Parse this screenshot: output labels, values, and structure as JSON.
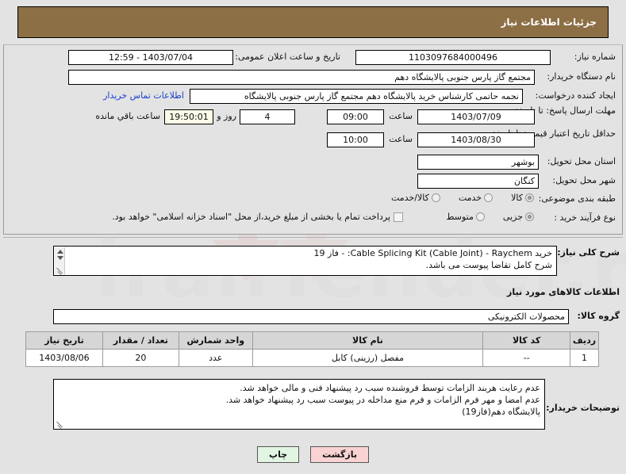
{
  "header": {
    "title": "جزئیات اطلاعات نیاز"
  },
  "watermark": {
    "text": "iranTender.net"
  },
  "top_form": {
    "need_number_label": "شماره نیاز:",
    "need_number_value": "1103097684000496",
    "announce_label": "تاریخ و ساعت اعلان عمومی:",
    "announce_value": "12:59 - 1403/07/04",
    "buyer_org_label": "نام دستگاه خریدار:",
    "buyer_org_value": "مجتمع گاز پارس جنوبی  پالایشگاه دهم",
    "requester_label": "ایجاد کننده درخواست:",
    "requester_value": "نجمه حاتمی کارشناس خرید پالایشگاه دهم  مجتمع گاز پارس جنوبی  پالایشگاه",
    "contact_link": "اطلاعات تماس خریدار",
    "deadline_label": "مهلت ارسال پاسخ: تا تاریخ:",
    "deadline_date": "1403/07/09",
    "deadline_hour_label": "ساعت",
    "deadline_hour": "09:00",
    "days_remaining": "4",
    "days_word": "روز و",
    "time_remaining": "19:50:01",
    "remaining_suffix": "ساعت باقي مانده",
    "validity_label": "حداقل تاریخ اعتبار قیمت: تا تاریخ:",
    "validity_date": "1403/08/30",
    "validity_hour_label": "ساعت",
    "validity_hour": "10:00",
    "province_label": "استان محل تحویل:",
    "province_value": "بوشهر",
    "city_label": "شهر محل تحویل:",
    "city_value": "کنگان",
    "category_label": "طبقه بندی موضوعی:",
    "category_options": [
      "کالا",
      "خدمت",
      "کالا/خدمت"
    ],
    "category_selected": "کالا",
    "process_label": "نوع فرآیند خرید :",
    "process_options": [
      "جزیی",
      "متوسط"
    ],
    "process_selected": "جزیی",
    "treasury_checkbox_label": "پرداخت تمام یا بخشی از مبلغ خرید،از محل \"اسناد خزانه اسلامی\" خواهد بود.",
    "treasury_checked": false
  },
  "description": {
    "label": "شرح کلی نیاز:",
    "line1": "خرید Cable Splicing Kit (Cable Joint) - Raychem: - فاز 19",
    "line2": "شرح کامل تقاضا پیوست می باشد."
  },
  "goods_section": {
    "title": "اطلاعات کالاهای مورد نیاز",
    "group_label": "گروه کالا:",
    "group_value": "محصولات الکترونیکی",
    "columns": [
      "ردیف",
      "کد کالا",
      "نام کالا",
      "واحد شمارش",
      "تعداد / مقدار",
      "تاریخ نیاز"
    ],
    "rows": [
      {
        "index": "1",
        "code": "--",
        "name": "مفصل (رزینی) کابل",
        "unit": "عدد",
        "qty": "20",
        "need_date": "1403/08/06"
      }
    ]
  },
  "buyer_notes": {
    "label": "توضیحات خریدار:",
    "line1": "عدم رعایت هربند الزامات توسط فروشنده سبب رد پیشنهاد فنی و مالی خواهد شد.",
    "line2": "عدم امضا و مهر فرم الزامات و فرم منع مداخله در پیوست سبب رد پیشنهاد خواهد شد.",
    "line3": "پالایشگاه دهم(فاز19)"
  },
  "footer": {
    "print_label": "چاپ",
    "back_label": "بازگشت"
  },
  "colors": {
    "header_bg": "#8d6f46",
    "page_bg": "#e3e3e3",
    "link": "#1a3fd0",
    "print_btn": "#e2f5e2",
    "back_btn": "#f9d3d3"
  }
}
